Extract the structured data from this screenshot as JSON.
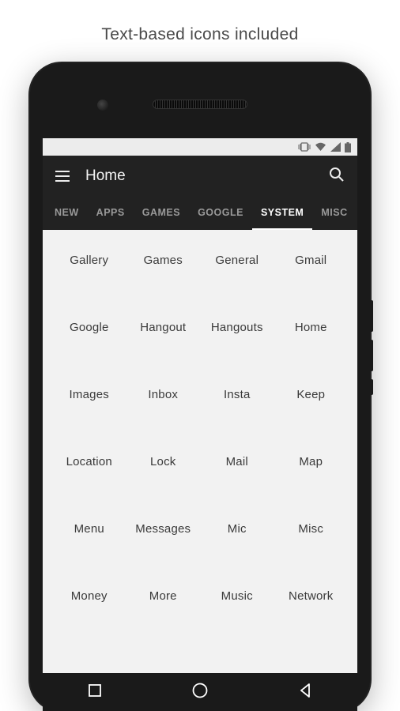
{
  "caption": "Text-based icons included",
  "appbar": {
    "title": "Home"
  },
  "tabs": [
    {
      "label": "NEW",
      "active": false
    },
    {
      "label": "APPS",
      "active": false
    },
    {
      "label": "GAMES",
      "active": false
    },
    {
      "label": "GOOGLE",
      "active": false
    },
    {
      "label": "SYSTEM",
      "active": true
    },
    {
      "label": "MISC",
      "active": false
    }
  ],
  "grid_items": [
    "Gallery",
    "Games",
    "General",
    "Gmail",
    "Google",
    "Hangout",
    "Hangouts",
    "Home",
    "Images",
    "Inbox",
    "Insta",
    "Keep",
    "Location",
    "Lock",
    "Mail",
    "Map",
    "Menu",
    "Messages",
    "Mic",
    "Misc",
    "Money",
    "More",
    "Music",
    "Network"
  ]
}
